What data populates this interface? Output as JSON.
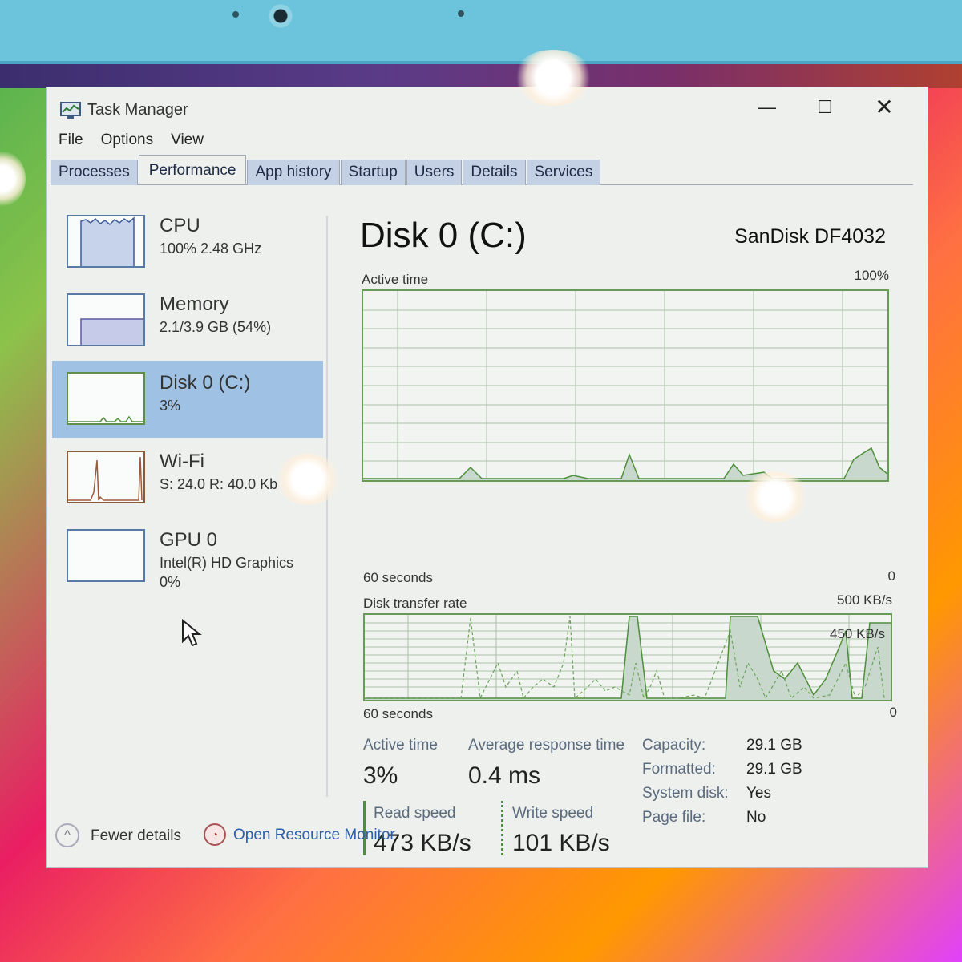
{
  "window": {
    "title": "Task Manager",
    "minimize_glyph": "—",
    "maximize_glyph": "☐",
    "close_glyph": "✕"
  },
  "menu": [
    "File",
    "Options",
    "View"
  ],
  "tabs": [
    "Processes",
    "Performance",
    "App history",
    "Startup",
    "Users",
    "Details",
    "Services"
  ],
  "active_tab": "Performance",
  "sidebar": [
    {
      "name": "CPU",
      "sub": "100% 2.48 GHz",
      "sub2": ""
    },
    {
      "name": "Memory",
      "sub": "2.1/3.9 GB (54%)",
      "sub2": ""
    },
    {
      "name": "Disk 0 (C:)",
      "sub": "3%",
      "sub2": ""
    },
    {
      "name": "Wi-Fi",
      "sub": "S: 24.0 R: 40.0 Kb",
      "sub2": ""
    },
    {
      "name": "GPU 0",
      "sub": "Intel(R) HD Graphics",
      "sub2": "0%"
    }
  ],
  "main": {
    "title": "Disk 0 (C:)",
    "model": "SanDisk DF4032",
    "active_graph": {
      "label": "Active time",
      "max": "100%",
      "time": "60 seconds",
      "min": "0"
    },
    "transfer_graph": {
      "label": "Disk transfer rate",
      "max": "500 KB/s",
      "inner": "450 KB/s",
      "time": "60 seconds",
      "min": "0"
    },
    "stats": {
      "active_time_label": "Active time",
      "active_time_value": "3%",
      "avg_response_label": "Average response time",
      "avg_response_value": "0.4 ms",
      "read_label": "Read speed",
      "read_value": "473 KB/s",
      "write_label": "Write speed",
      "write_value": "101 KB/s"
    },
    "properties": [
      {
        "label": "Capacity:",
        "value": "29.1 GB"
      },
      {
        "label": "Formatted:",
        "value": "29.1 GB"
      },
      {
        "label": "System disk:",
        "value": "Yes"
      },
      {
        "label": "Page file:",
        "value": "No"
      }
    ]
  },
  "footer": {
    "fewer_details": "Fewer details",
    "open_resource_monitor": "Open Resource Monitor"
  },
  "colors": {
    "disk_line": "#4e8f3a",
    "disk_fill": "#c9d8cc",
    "grid": "#a9c2a5",
    "selected": "#9fc2e4",
    "link": "#2a5fa8"
  }
}
